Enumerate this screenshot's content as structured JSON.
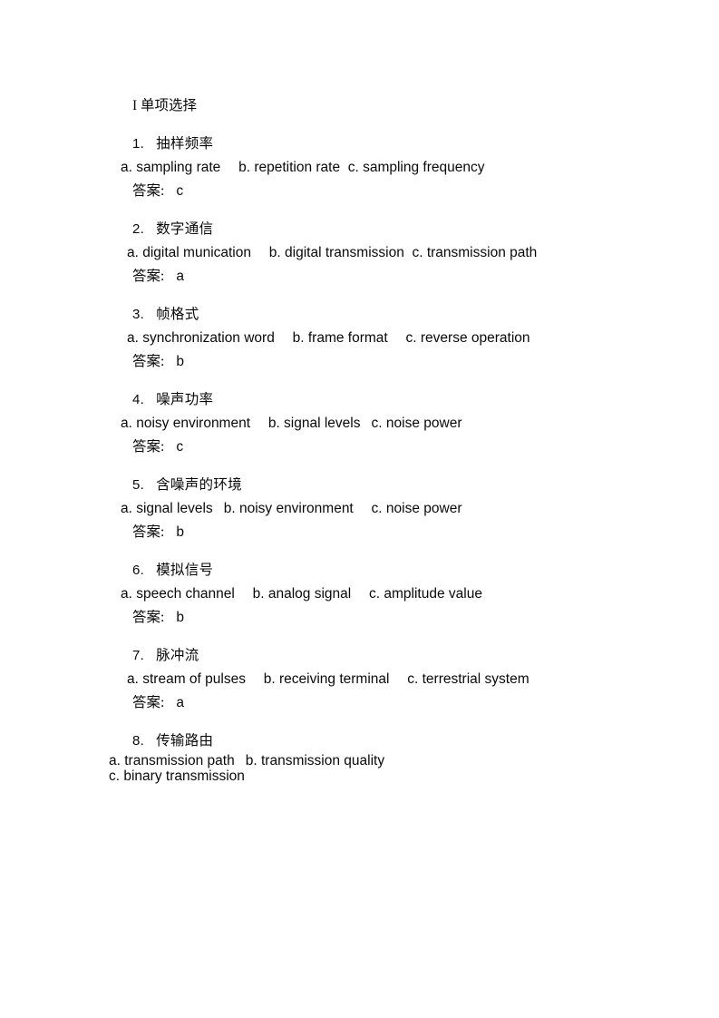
{
  "document": {
    "title_line": "I 单项选择",
    "title_roman": "I",
    "title_cn": "单项选择",
    "answer_label": "答案:",
    "questions": [
      {
        "number": "1.",
        "term": "抽样频率",
        "options_line": "a. sampling rate  b. repetition rate  c. sampling frequency",
        "option_a": "a. sampling rate",
        "option_b": "b. repetition rate",
        "option_c": "c. sampling frequency",
        "answer": "c",
        "justified": false,
        "tight": false
      },
      {
        "number": "2.",
        "term": "数字通信",
        "options_line": "a. digital munication  b. digital transmission  c. transmission path",
        "option_a": "a. digital munication",
        "option_b": "b. digital transmission",
        "option_c": "c. transmission path",
        "answer": "a",
        "justified": true,
        "tight": false
      },
      {
        "number": "3.",
        "term": "帧格式",
        "options_line": "a. synchronization word  b. frame format  c. reverse operation",
        "option_a": "a. synchronization word",
        "option_b": "b. frame format",
        "option_c": "c. reverse operation",
        "answer": "b",
        "justified": true,
        "tight": false
      },
      {
        "number": "4.",
        "term": "噪声功率",
        "options_line": "a. noisy environment  b. signal levels  c. noise power",
        "option_a": "a. noisy environment",
        "option_b": "b. signal levels",
        "option_c": "c. noise power",
        "answer": "c",
        "justified": false,
        "tight": false
      },
      {
        "number": "5.",
        "term": "含噪声的环境",
        "options_line": "a. signal levels  b. noisy environment  c. noise power",
        "option_a": "a. signal levels",
        "option_b": "b. noisy environment",
        "option_c": "c. noise power",
        "answer": "b",
        "justified": false,
        "tight": false
      },
      {
        "number": "6.",
        "term": "模拟信号",
        "options_line": "a. speech channel  b. analog signal  c. amplitude value",
        "option_a": "a. speech channel",
        "option_b": "b. analog signal",
        "option_c": "c. amplitude value",
        "answer": "b",
        "justified": false,
        "tight": false
      },
      {
        "number": "7.",
        "term": "脉冲流",
        "options_line": "a. stream of pulses  b. receiving terminal  c. terrestrial system",
        "option_a": "a. stream of pulses",
        "option_b": "b. receiving terminal",
        "option_c": "c. terrestrial system",
        "answer": "a",
        "justified": true,
        "tight": false
      },
      {
        "number": "8.",
        "term": "传输路由",
        "options_line_1": "a. transmission path  b. transmission quality",
        "options_line_2": "c. binary transmission",
        "option_a": "a. transmission path",
        "option_b": "b. transmission quality",
        "option_c": "c. binary transmission",
        "answer": "",
        "justified": false,
        "tight": true
      }
    ]
  }
}
